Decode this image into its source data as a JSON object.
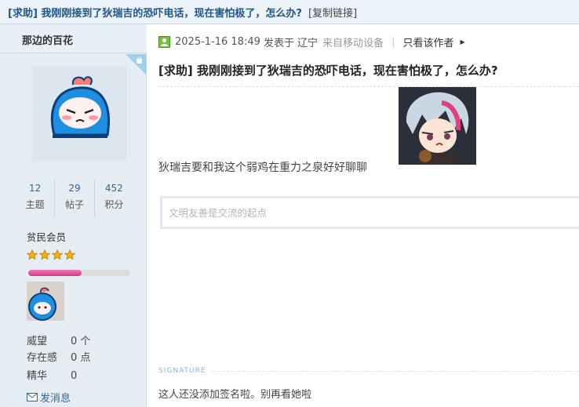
{
  "thread": {
    "title": "[求助] 我刚刚接到了狄瑞吉的恐吓电话，现在害怕极了，怎么办?",
    "copy_link": "[复制链接]"
  },
  "author": {
    "name": "那边的百花",
    "stats": [
      {
        "value": "12",
        "label": "主题"
      },
      {
        "value": "29",
        "label": "帖子"
      },
      {
        "value": "452",
        "label": "积分"
      }
    ],
    "rank": "贫民会员",
    "star_count": 4,
    "level_progress": 0.52,
    "props": [
      {
        "key": "威望",
        "value": "0 个"
      },
      {
        "key": "存在感",
        "value": "0 点"
      },
      {
        "key": "精华",
        "value": "0"
      }
    ],
    "send_message": "发消息"
  },
  "post": {
    "datetime": "2025-1-16 18:49",
    "posted_in": "发表于",
    "location": "辽宁",
    "mobile": "来自移动设备",
    "only_author": "只看该作者",
    "subject": "[求助] 我刚刚接到了狄瑞吉的恐吓电话，现在害怕极了，怎么办?",
    "body": "狄瑞吉要和我这个弱鸡在重力之泉好好聊聊",
    "reply_placeholder": "文明友善是交流的起点",
    "signature_label": "SIGNATURE",
    "signature": "这人还没添加签名啦。别再看她啦"
  },
  "colors": {
    "link_blue": "#336699",
    "title_blue": "#225588",
    "sidebar_bg": "#e5edf2",
    "progress_pink": "#d63487",
    "star_gold": "#f5b400"
  },
  "icons": [
    "android-icon",
    "online-status-icon",
    "arrow-right-icon",
    "star-icon",
    "mail-icon"
  ]
}
